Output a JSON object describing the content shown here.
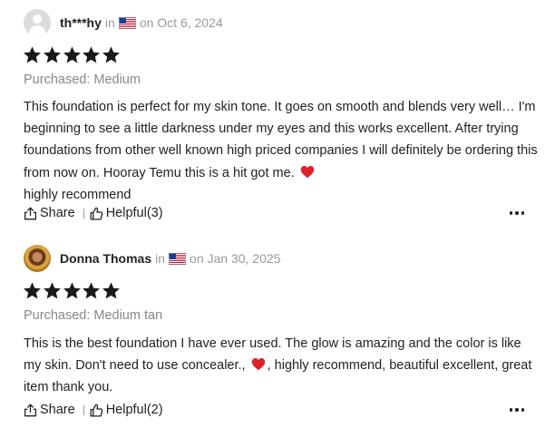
{
  "reviews": [
    {
      "username": "th***hy",
      "in_label": "in",
      "flag_icon": "us-flag-icon",
      "date": "on Oct 6, 2024",
      "rating": 5,
      "purchased": "Purchased: Medium",
      "text_before_heart": "This foundation is perfect for my skin tone. It goes on smooth and blends very well… I'm beginning to see a little darkness under my eyes and this works excellent. After trying foundations from other well known high priced companies I will definitely be ordering this from now on. Hooray Temu this is a hit got me.",
      "text_after_heart": "highly recommend",
      "share_label": "Share",
      "helpful_label": "Helpful(3)"
    },
    {
      "username": "Donna Thomas",
      "in_label": "in",
      "flag_icon": "us-flag-icon",
      "date": "on Jan 30, 2025",
      "rating": 5,
      "purchased": "Purchased: Medium tan",
      "text_before_heart": "This is the best foundation I have ever used. The glow is amazing and the color is like my skin. Don't need to use concealer.,",
      "text_after_heart": ", highly recommend, beautiful excellent, great item thank you.",
      "share_label": "Share",
      "helpful_label": "Helpful(2)"
    }
  ],
  "colors": {
    "star": "#1a1a1a",
    "heart": "#e0202b",
    "meta_text": "#9a9a9a"
  }
}
